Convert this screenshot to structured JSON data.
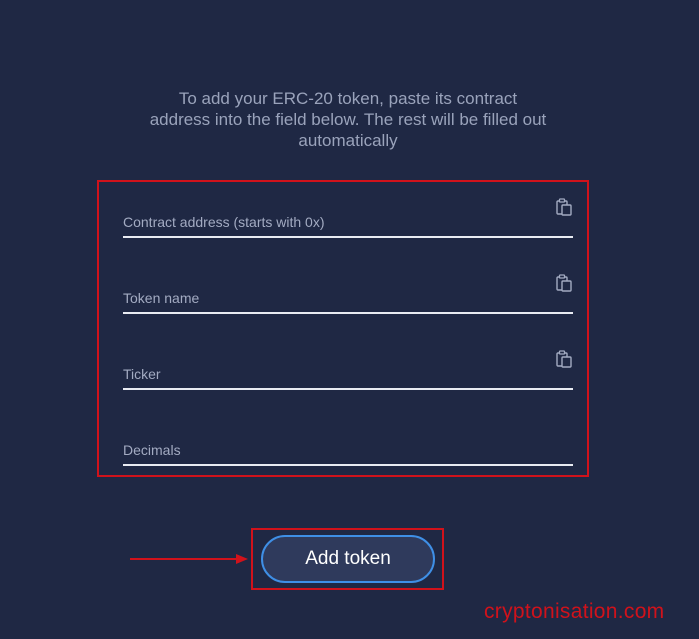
{
  "intro_text": "To add your ERC-20 token, paste its contract address into the field below. The rest will be filled out automatically",
  "form": {
    "fields": [
      {
        "key": "contract_address",
        "placeholder": "Contract address (starts with 0x)",
        "value": "",
        "paste_icon": "clipboard-paste-icon"
      },
      {
        "key": "token_name",
        "placeholder": "Token name",
        "value": "",
        "paste_icon": "clipboard-paste-icon"
      },
      {
        "key": "ticker",
        "placeholder": "Ticker",
        "value": "",
        "paste_icon": "clipboard-paste-icon"
      },
      {
        "key": "decimals",
        "placeholder": "Decimals",
        "value": ""
      }
    ]
  },
  "add_button_label": "Add token",
  "watermark": "cryptonisation.com",
  "colors": {
    "background": "#1f2844",
    "highlight_red": "#d0121b",
    "button_border": "#3f8fe6",
    "button_fill": "#2f3a5c",
    "intro_text": "#9aa3bb"
  }
}
